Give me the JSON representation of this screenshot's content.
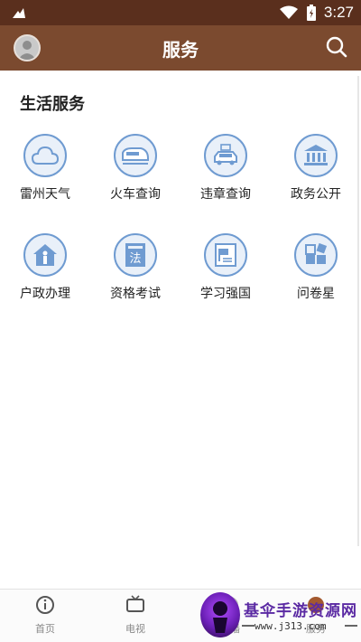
{
  "status_bar": {
    "time": "3:27"
  },
  "header": {
    "title": "服务"
  },
  "section": {
    "title": "生活服务"
  },
  "services": [
    {
      "label": "雷州天气",
      "icon": "cloud-icon"
    },
    {
      "label": "火车查询",
      "icon": "train-icon"
    },
    {
      "label": "违章查询",
      "icon": "car-icon"
    },
    {
      "label": "政务公开",
      "icon": "government-building-icon"
    },
    {
      "label": "户政办理",
      "icon": "house-person-icon"
    },
    {
      "label": "资格考试",
      "icon": "law-book-icon"
    },
    {
      "label": "学习强国",
      "icon": "study-flag-icon"
    },
    {
      "label": "问卷星",
      "icon": "questionnaire-grid-icon"
    }
  ],
  "tabs": [
    {
      "label": "首页",
      "icon": "info-icon"
    },
    {
      "label": "电视",
      "icon": "tv-icon"
    },
    {
      "label": "直播",
      "icon": "live-icon"
    },
    {
      "label": "服务",
      "icon": "service-icon"
    }
  ],
  "watermark": {
    "text": "基伞手游资源网",
    "url": "www.j313.com"
  },
  "colors": {
    "header": "#7b4a2f",
    "status_bar": "#5a2f1d",
    "icon_border": "#6f9bd1",
    "icon_fill": "#e9f0f9"
  }
}
